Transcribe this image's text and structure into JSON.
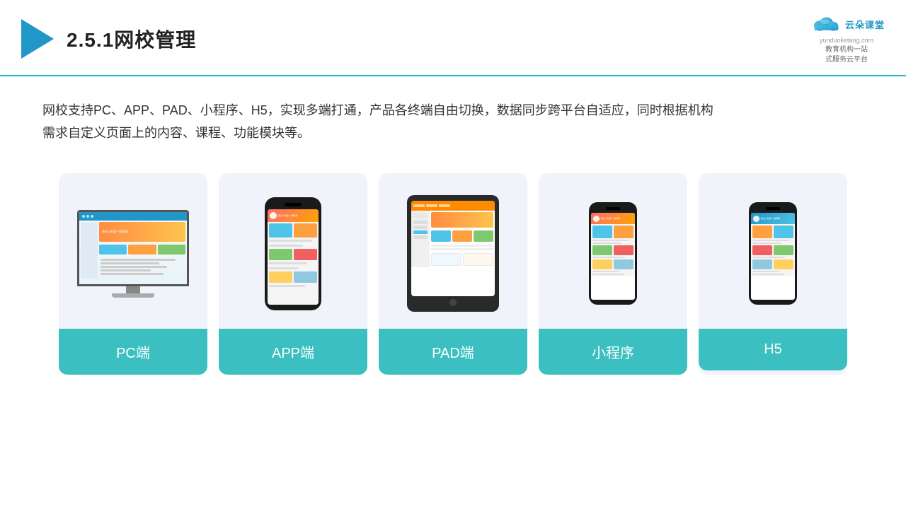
{
  "header": {
    "title": "2.5.1网校管理",
    "brand_name": "云朵课堂",
    "brand_url": "yunduoketang.com",
    "brand_tagline": "教育机构一站\n式服务云平台"
  },
  "description": {
    "text": "网校支持PC、APP、PAD、小程序、H5，实现多端打通，产品各终端自由切换，数据同步跨平台自适应，同时根据机构\n需求自定义页面上的内容、课程、功能模块等。"
  },
  "cards": [
    {
      "id": "pc",
      "label": "PC端"
    },
    {
      "id": "app",
      "label": "APP端"
    },
    {
      "id": "pad",
      "label": "PAD端"
    },
    {
      "id": "miniprogram",
      "label": "小程序"
    },
    {
      "id": "h5",
      "label": "H5"
    }
  ],
  "colors": {
    "primary": "#2196c8",
    "teal": "#3bbfc0",
    "bg_card": "#f0f4fa",
    "border_accent": "#1cb8c8",
    "orange": "#ff8c42",
    "yellow": "#ffc34d"
  }
}
